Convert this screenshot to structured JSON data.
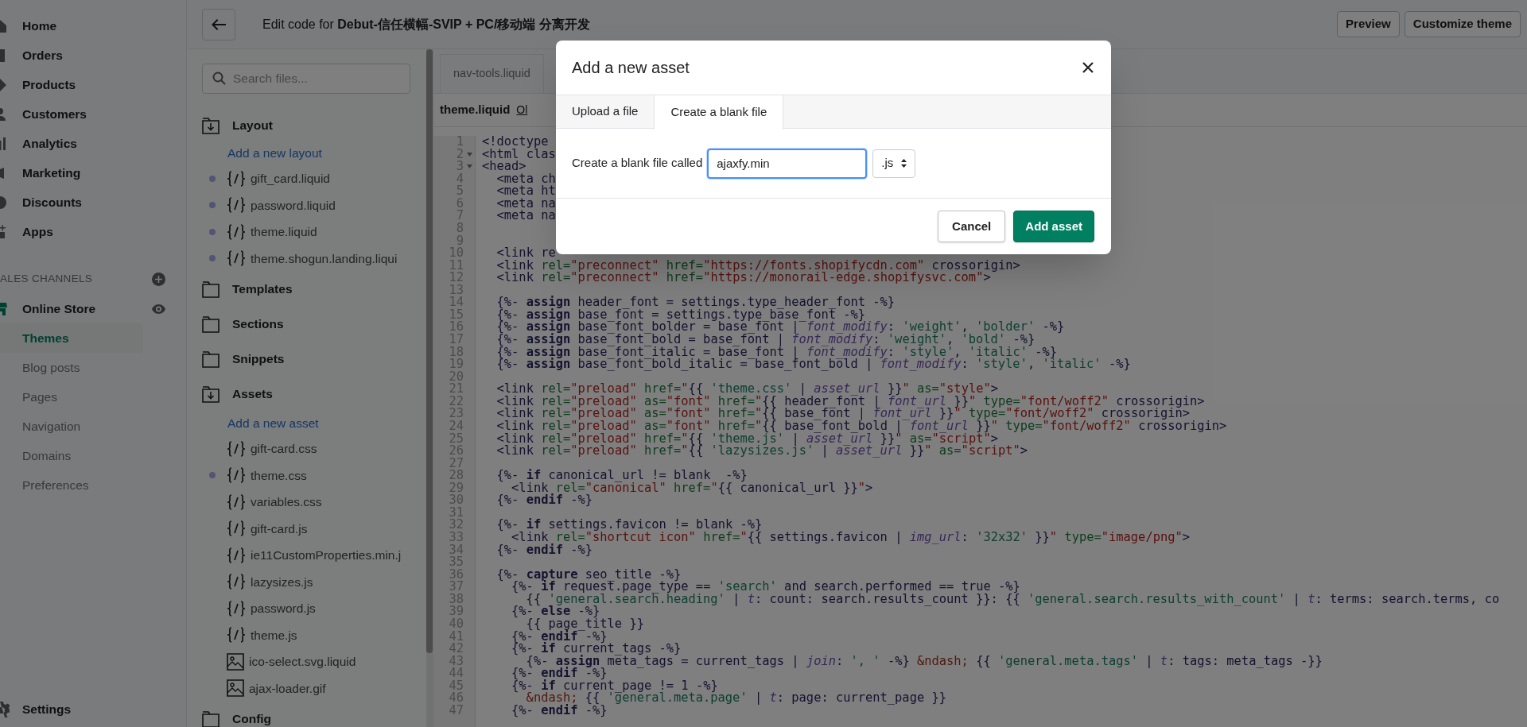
{
  "nav": {
    "items": [
      {
        "label": "Home",
        "selected": false
      },
      {
        "label": "Orders",
        "selected": false
      },
      {
        "label": "Products",
        "selected": false
      },
      {
        "label": "Customers",
        "selected": false
      },
      {
        "label": "Analytics",
        "selected": false
      },
      {
        "label": "Marketing",
        "selected": false
      },
      {
        "label": "Discounts",
        "selected": false
      },
      {
        "label": "Apps",
        "selected": false
      }
    ],
    "channels_heading": "ALES CHANNELS",
    "channels": [
      {
        "label": "Online Store",
        "kind": "main",
        "selected": false
      },
      {
        "label": "Themes",
        "kind": "sub",
        "selected": true
      },
      {
        "label": "Blog posts",
        "kind": "sub",
        "selected": false
      },
      {
        "label": "Pages",
        "kind": "sub",
        "selected": false
      },
      {
        "label": "Navigation",
        "kind": "sub",
        "selected": false
      },
      {
        "label": "Domains",
        "kind": "sub",
        "selected": false
      },
      {
        "label": "Preferences",
        "kind": "sub",
        "selected": false
      }
    ],
    "settings": "Settings"
  },
  "header": {
    "title": "Edit code for **Debut-信任横幅-SVIP + PC/移动端 分离开发**",
    "buttons": [
      "Preview",
      "Customize theme"
    ]
  },
  "files": {
    "search_placeholder": "Search files...",
    "folders": [
      {
        "name": "Layout",
        "expanded": true,
        "add_link": "Add a new layout",
        "files": [
          {
            "name": "gift_card.liquid",
            "kind": "code",
            "modified": true
          },
          {
            "name": "password.liquid",
            "kind": "code",
            "modified": true
          },
          {
            "name": "theme.liquid",
            "kind": "code",
            "modified": true
          },
          {
            "name": "theme.shogun.landing.liqui",
            "kind": "code",
            "modified": true
          }
        ]
      },
      {
        "name": "Templates",
        "expanded": false
      },
      {
        "name": "Sections",
        "expanded": false
      },
      {
        "name": "Snippets",
        "expanded": false
      },
      {
        "name": "Assets",
        "expanded": true,
        "add_link": "Add a new asset",
        "files": [
          {
            "name": "gift-card.css",
            "kind": "code",
            "modified": false
          },
          {
            "name": "theme.css",
            "kind": "code",
            "modified": true
          },
          {
            "name": "variables.css",
            "kind": "code",
            "modified": false
          },
          {
            "name": "gift-card.js",
            "kind": "code",
            "modified": false
          },
          {
            "name": "ie11CustomProperties.min.j",
            "kind": "code",
            "modified": false
          },
          {
            "name": "lazysizes.js",
            "kind": "code",
            "modified": false
          },
          {
            "name": "password.js",
            "kind": "code",
            "modified": false
          },
          {
            "name": "theme.js",
            "kind": "code",
            "modified": false
          },
          {
            "name": "ico-select.svg.liquid",
            "kind": "image",
            "modified": false
          },
          {
            "name": "ajax-loader.gif",
            "kind": "image",
            "modified": false
          }
        ]
      },
      {
        "name": "Config",
        "expanded": false
      }
    ]
  },
  "editor": {
    "tab": "nav-tools.liquid",
    "file": "theme.liquid",
    "old_versions_link": "Ol",
    "lines": [
      {
        "n": "1",
        "code": "<!doctype",
        "fold": false
      },
      {
        "n": "2",
        "code": "<html clas",
        "fold": true
      },
      {
        "n": "3",
        "code": "<head>",
        "fold": true
      },
      {
        "n": "4",
        "code": "  <meta ch",
        "fold": false
      },
      {
        "n": "5",
        "code": "  <meta ht",
        "fold": false
      },
      {
        "n": "6",
        "code": "  <meta na",
        "fold": false
      },
      {
        "n": "7",
        "code": "  <meta na",
        "fold": false
      },
      {
        "n": "8",
        "fold": false
      },
      {
        "n": "9",
        "fold": false
      },
      {
        "n": "10",
        "code": "  <link re",
        "fold": false
      },
      {
        "n": "11",
        "code": "  <link rel=\"preconnect\" href=\"https://fonts.shopifycdn.com\" crossorigin>",
        "fold": false
      },
      {
        "n": "12",
        "code": "  <link rel=\"preconnect\" href=\"https://monorail-edge.shopifysvc.com\">",
        "fold": false
      },
      {
        "n": "13",
        "fold": false
      },
      {
        "n": "14",
        "code": "  {%- assign header_font = settings.type_header_font -%}",
        "fold": false
      },
      {
        "n": "15",
        "code": "  {%- assign base_font = settings.type_base_font -%}",
        "fold": false
      },
      {
        "n": "16",
        "code": "  {%- assign base_font_bolder = base_font | font_modify: 'weight', 'bolder' -%}",
        "fold": false
      },
      {
        "n": "17",
        "code": "  {%- assign base_font_bold = base_font | font_modify: 'weight', 'bold' -%}",
        "fold": false
      },
      {
        "n": "18",
        "code": "  {%- assign base_font_italic = base_font | font_modify: 'style', 'italic' -%}",
        "fold": false
      },
      {
        "n": "19",
        "code": "  {%- assign base_font_bold_italic = base_font_bold | font_modify: 'style', 'italic' -%}",
        "fold": false
      },
      {
        "n": "20",
        "fold": false
      },
      {
        "n": "21",
        "code": "  <link rel=\"preload\" href=\"{{ 'theme.css' | asset_url }}\" as=\"style\">",
        "fold": false
      },
      {
        "n": "22",
        "code": "  <link rel=\"preload\" as=\"font\" href=\"{{ header_font | font_url }}\" type=\"font/woff2\" crossorigin>",
        "fold": false
      },
      {
        "n": "23",
        "code": "  <link rel=\"preload\" as=\"font\" href=\"{{ base_font | font_url }}\" type=\"font/woff2\" crossorigin>",
        "fold": false
      },
      {
        "n": "24",
        "code": "  <link rel=\"preload\" as=\"font\" href=\"{{ base_font_bold | font_url }}\" type=\"font/woff2\" crossorigin>",
        "fold": false
      },
      {
        "n": "25",
        "code": "  <link rel=\"preload\" href=\"{{ 'theme.js' | asset_url }}\" as=\"script\">",
        "fold": false
      },
      {
        "n": "26",
        "code": "  <link rel=\"preload\" href=\"{{ 'lazysizes.js' | asset_url }}\" as=\"script\">",
        "fold": false
      },
      {
        "n": "27",
        "fold": false
      },
      {
        "n": "28",
        "code": "  {%- if canonical_url != blank  -%}",
        "fold": false
      },
      {
        "n": "29",
        "code": "    <link rel=\"canonical\" href=\"{{ canonical_url }}\">",
        "fold": false
      },
      {
        "n": "30",
        "code": "  {%- endif -%}",
        "fold": false
      },
      {
        "n": "31",
        "fold": false
      },
      {
        "n": "32",
        "code": "  {%- if settings.favicon != blank -%}",
        "fold": false
      },
      {
        "n": "33",
        "code": "    <link rel=\"shortcut icon\" href=\"{{ settings.favicon | img_url: '32x32' }}\" type=\"image/png\">",
        "fold": false
      },
      {
        "n": "34",
        "code": "  {%- endif -%}",
        "fold": false
      },
      {
        "n": "35",
        "fold": false
      },
      {
        "n": "36",
        "code": "  {%- capture seo_title -%}",
        "fold": false
      },
      {
        "n": "37",
        "code": "    {%- if request.page_type == 'search' and search.performed == true -%}",
        "fold": false
      },
      {
        "n": "38",
        "code": "      {{ 'general.search.heading' | t: count: search.results_count }}: {{ 'general.search.results_with_count' | t: terms: search.terms, co",
        "fold": false
      },
      {
        "n": "39",
        "code": "    {%- else -%}",
        "fold": false
      },
      {
        "n": "40",
        "code": "      {{ page_title }}",
        "fold": false
      },
      {
        "n": "41",
        "code": "    {%- endif -%}",
        "fold": false
      },
      {
        "n": "42",
        "code": "    {%- if current_tags -%}",
        "fold": false
      },
      {
        "n": "43",
        "code": "      {%- assign meta_tags = current_tags | join: ', ' -%} &ndash; {{ 'general.meta.tags' | t: tags: meta_tags -}}",
        "fold": false
      },
      {
        "n": "44",
        "code": "    {%- endif -%}",
        "fold": false
      },
      {
        "n": "45",
        "code": "    {%- if current_page != 1 -%}",
        "fold": false
      },
      {
        "n": "46",
        "code": "      &ndash; {{ 'general.meta.page' | t: page: current_page }}",
        "fold": false
      },
      {
        "n": "47",
        "code": "    {%- endif -%}",
        "fold": false
      }
    ]
  },
  "modal": {
    "title": "Add a new asset",
    "tabs": [
      {
        "label": "Upload a file",
        "selected": false
      },
      {
        "label": "Create a blank file",
        "selected": true
      }
    ],
    "field_label": "Create a blank file called",
    "field_value": "ajaxfy.min",
    "extension": ".js",
    "buttons": [
      {
        "label": "Cancel",
        "kind": "secondary"
      },
      {
        "label": "Add asset",
        "kind": "primary"
      }
    ]
  }
}
